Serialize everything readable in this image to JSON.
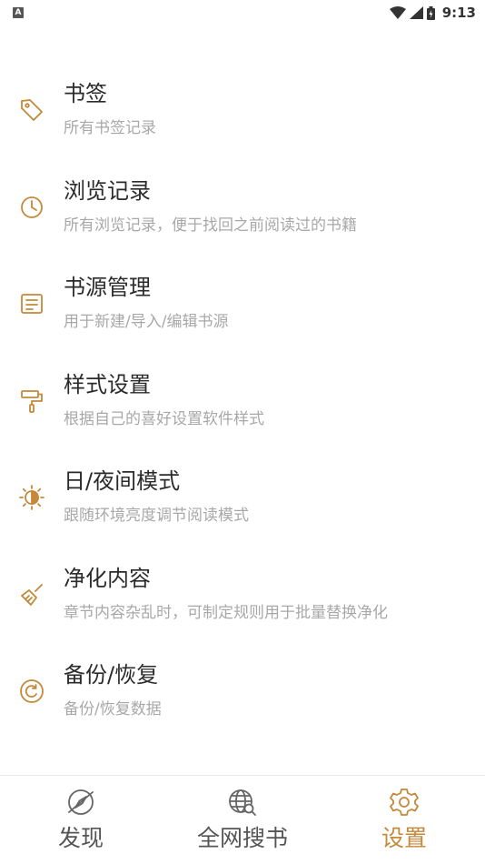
{
  "status_bar": {
    "notification_icon_text": "A",
    "time": "9:13"
  },
  "colors": {
    "accent": "#c4893a",
    "title": "#2b2b2b",
    "subtitle": "#a8a8a8",
    "nav_inactive": "#666666"
  },
  "settings": {
    "items": [
      {
        "icon": "tag-icon",
        "title": "书签",
        "subtitle": "所有书签记录"
      },
      {
        "icon": "clock-icon",
        "title": "浏览记录",
        "subtitle": "所有浏览记录，便于找回之前阅读过的书籍"
      },
      {
        "icon": "document-icon",
        "title": "书源管理",
        "subtitle": "用于新建/导入/编辑书源"
      },
      {
        "icon": "paint-roller-icon",
        "title": "样式设置",
        "subtitle": "根据自己的喜好设置软件样式"
      },
      {
        "icon": "brightness-icon",
        "title": "日/夜间模式",
        "subtitle": "跟随环境亮度调节阅读模式"
      },
      {
        "icon": "broom-icon",
        "title": "净化内容",
        "subtitle": "章节内容杂乱时，可制定规则用于批量替换净化"
      },
      {
        "icon": "restore-icon",
        "title": "备份/恢复",
        "subtitle": "备份/恢复数据"
      }
    ]
  },
  "bottom_nav": {
    "items": [
      {
        "icon": "compass-icon",
        "label": "发现"
      },
      {
        "icon": "globe-search-icon",
        "label": "全网搜书"
      },
      {
        "icon": "gear-icon",
        "label": "设置",
        "active": true
      }
    ]
  }
}
